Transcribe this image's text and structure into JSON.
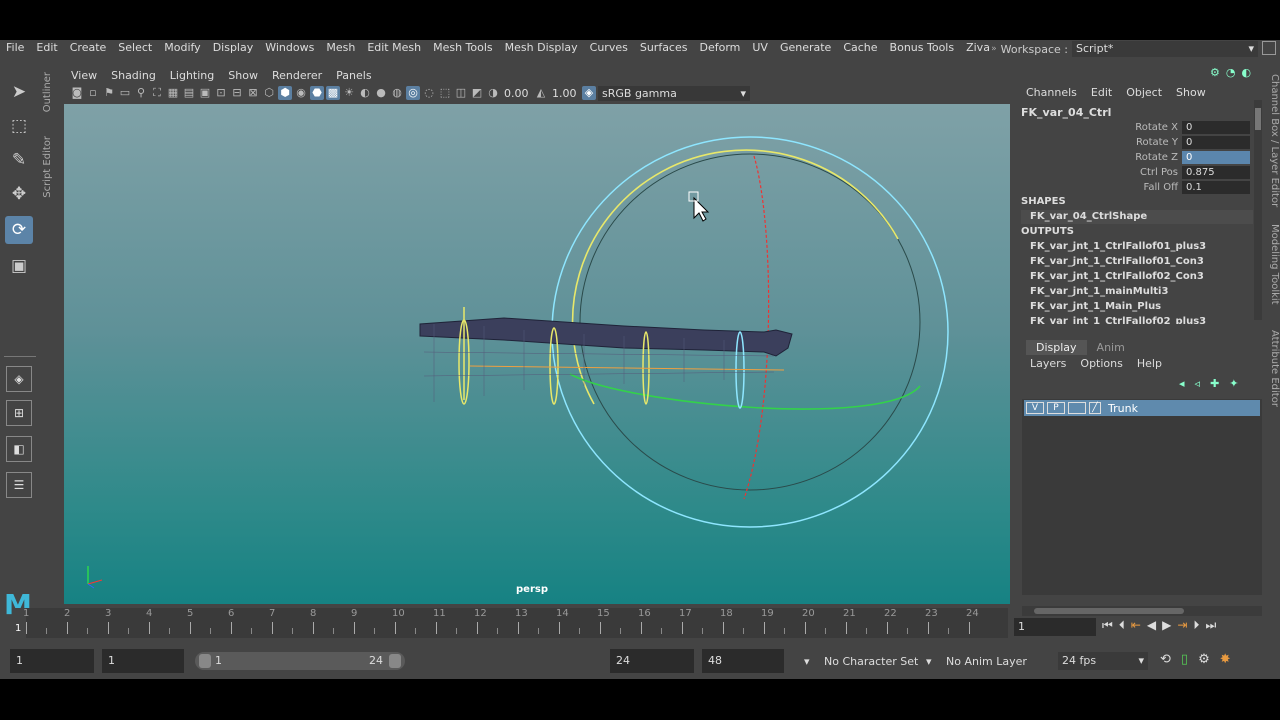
{
  "menubar": {
    "items": [
      "File",
      "Edit",
      "Create",
      "Select",
      "Modify",
      "Display",
      "Windows",
      "Mesh",
      "Edit Mesh",
      "Mesh Tools",
      "Mesh Display",
      "Curves",
      "Surfaces",
      "Deform",
      "UV",
      "Generate",
      "Cache",
      "Bonus Tools",
      "Ziva"
    ],
    "workspace_label": "Workspace :",
    "workspace_value": "Script*"
  },
  "left_tabs": {
    "outliner": "Outliner",
    "script_editor": "Script Editor"
  },
  "panel_menu": [
    "View",
    "Shading",
    "Lighting",
    "Show",
    "Renderer",
    "Panels"
  ],
  "viewport_toolbar": {
    "exposure": "0.00",
    "gamma": "1.00",
    "color_space": "sRGB gamma"
  },
  "viewport": {
    "camera_label": "persp"
  },
  "channel_box": {
    "menu": [
      "Channels",
      "Edit",
      "Object",
      "Show"
    ],
    "node_name": "FK_var_04_Ctrl",
    "attributes": [
      {
        "name": "Rotate X",
        "value": "0"
      },
      {
        "name": "Rotate Y",
        "value": "0"
      },
      {
        "name": "Rotate Z",
        "value": "0"
      },
      {
        "name": "Ctrl Pos",
        "value": "0.875"
      },
      {
        "name": "Fall Off",
        "value": "0.1"
      }
    ],
    "shapes_header": "SHAPES",
    "shape": "FK_var_04_CtrlShape",
    "outputs_header": "OUTPUTS",
    "outputs": [
      "FK_var_jnt_1_CtrlFallof01_plus3",
      "FK_var_jnt_1_CtrlFallof01_Con3",
      "FK_var_jnt_1_CtrlFallof02_Con3",
      "FK_var_jnt_1_mainMulti3",
      "FK_var_jnt_1_Main_Plus",
      "FK_var_jnt_1_CtrlFallof02_plus3"
    ]
  },
  "layer_editor": {
    "tabs": [
      "Display",
      "Anim"
    ],
    "menu": [
      "Layers",
      "Options",
      "Help"
    ],
    "layer": {
      "v": "V",
      "p": "P",
      "name": "Trunk"
    }
  },
  "side_tabs": {
    "channel_box_layer": "Channel Box / Layer Editor",
    "modeling_toolkit": "Modeling Toolkit",
    "attribute_editor": "Attribute Editor"
  },
  "timeline": {
    "labels": [
      "1",
      "2",
      "3",
      "4",
      "5",
      "6",
      "7",
      "8",
      "9",
      "10",
      "11",
      "12",
      "13",
      "14",
      "15",
      "16",
      "17",
      "18",
      "19",
      "20",
      "21",
      "22",
      "23",
      "24"
    ],
    "current": "1",
    "current_field": "1"
  },
  "range": {
    "start": "1",
    "playback_start": "1",
    "slider_start": "1",
    "slider_end": "24",
    "playback_end": "24",
    "end": "48",
    "character_set": "No Character Set",
    "anim_layer": "No Anim Layer",
    "fps": "24 fps"
  },
  "colors": {
    "accent": "#5b86ad",
    "viewport_top": "#7fa1a7",
    "viewport_bottom": "#168283"
  }
}
